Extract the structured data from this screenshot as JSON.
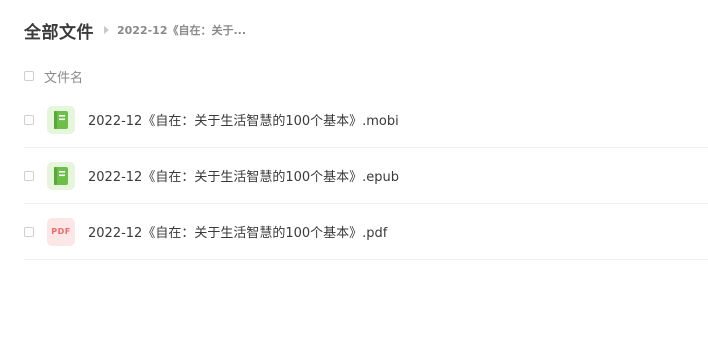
{
  "header": {
    "title": "全部文件",
    "breadcrumb": "2022-12《自在：关于..."
  },
  "list": {
    "column_name": "文件名",
    "files": [
      {
        "name": "2022-12《自在：关于生活智慧的100个基本》.mobi",
        "icon": "ebook-icon"
      },
      {
        "name": "2022-12《自在：关于生活智慧的100个基本》.epub",
        "icon": "ebook-icon"
      },
      {
        "name": "2022-12《自在：关于生活智慧的100个基本》.pdf",
        "icon": "pdf-icon",
        "icon_text": "PDF"
      }
    ]
  },
  "colors": {
    "ebook_icon_bg": "#e6f6dd",
    "ebook_icon_fg": "#6cc04a",
    "pdf_icon_bg": "#fde6e6",
    "pdf_icon_fg": "#f06a6a"
  }
}
